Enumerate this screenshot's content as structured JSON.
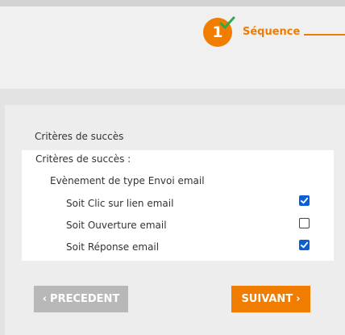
{
  "stepper": {
    "step_number": "1",
    "step_label": "Séquence",
    "completed": true,
    "accent_color": "#f07c00",
    "check_color": "#2eaa4a"
  },
  "criteria": {
    "section_title": "Critères de succès",
    "box_title": "Critères de succès :",
    "event_label": "Evènement de type Envoi email",
    "options": [
      {
        "label": "Soit Clic sur lien email",
        "checked": true
      },
      {
        "label": "Soit Ouverture email",
        "checked": false
      },
      {
        "label": "Soit Réponse email",
        "checked": true
      }
    ]
  },
  "nav": {
    "prev_label": "PRECEDENT",
    "prev_icon": "chevron-left-icon",
    "next_label": "SUIVANT",
    "next_icon": "chevron-right-icon",
    "checkbox_color": "#0a5fd7"
  }
}
